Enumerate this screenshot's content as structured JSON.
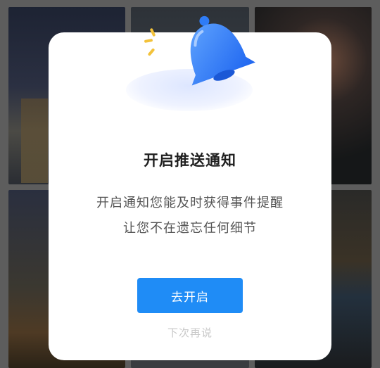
{
  "dialog": {
    "icon": "notification-bell-icon",
    "title": "开启推送通知",
    "description_line1": "开启通知您能及时获得事件提醒",
    "description_line2": "让您不在遗忘任何细节",
    "primary_button_label": "去开启",
    "secondary_link_label": "下次再说"
  },
  "colors": {
    "primary": "#1f8cf6",
    "bell": "#2f7cf6",
    "accent_ray": "#f3c23a",
    "backdrop": "#5d5d5d"
  },
  "background": {
    "type": "dimmed-photo-grid",
    "tiles": 6
  }
}
